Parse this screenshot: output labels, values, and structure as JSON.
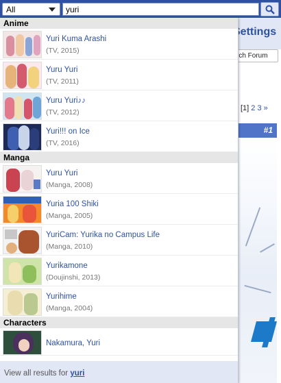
{
  "search": {
    "category": "All",
    "query": "yuri"
  },
  "background": {
    "settings_label": "Settings",
    "forum_button": "rch Forum",
    "pagination": {
      "current": "[1]",
      "pages": [
        "2",
        "3",
        "»"
      ]
    },
    "rank": "#1"
  },
  "results": {
    "anime_header": "Anime",
    "anime": [
      {
        "title": "Yuri Kuma Arashi",
        "meta": "(TV, 2015)"
      },
      {
        "title": "Yuru Yuri",
        "meta": "(TV, 2011)"
      },
      {
        "title": "Yuru Yuri♪♪",
        "meta": "(TV, 2012)"
      },
      {
        "title": "Yuri!!! on Ice",
        "meta": "(TV, 2016)"
      }
    ],
    "manga_header": "Manga",
    "manga": [
      {
        "title": "Yuru Yuri",
        "meta": "(Manga, 2008)"
      },
      {
        "title": "Yuria 100 Shiki",
        "meta": "(Manga, 2005)"
      },
      {
        "title": "YuriCam: Yurika no Campus Life",
        "meta": "(Manga, 2010)"
      },
      {
        "title": "Yurikamone",
        "meta": "(Doujinshi, 2013)"
      },
      {
        "title": "Yurihime",
        "meta": "(Manga, 2004)"
      }
    ],
    "characters_header": "Characters",
    "characters": [
      {
        "name": "Nakamura, Yuri"
      }
    ],
    "view_all_prefix": "View all results for",
    "view_all_query": "yuri"
  },
  "colors": {
    "brand": "#2e51a2",
    "dropdown_footer": "#e1e7f5",
    "section_header": "#e6e6e6"
  }
}
